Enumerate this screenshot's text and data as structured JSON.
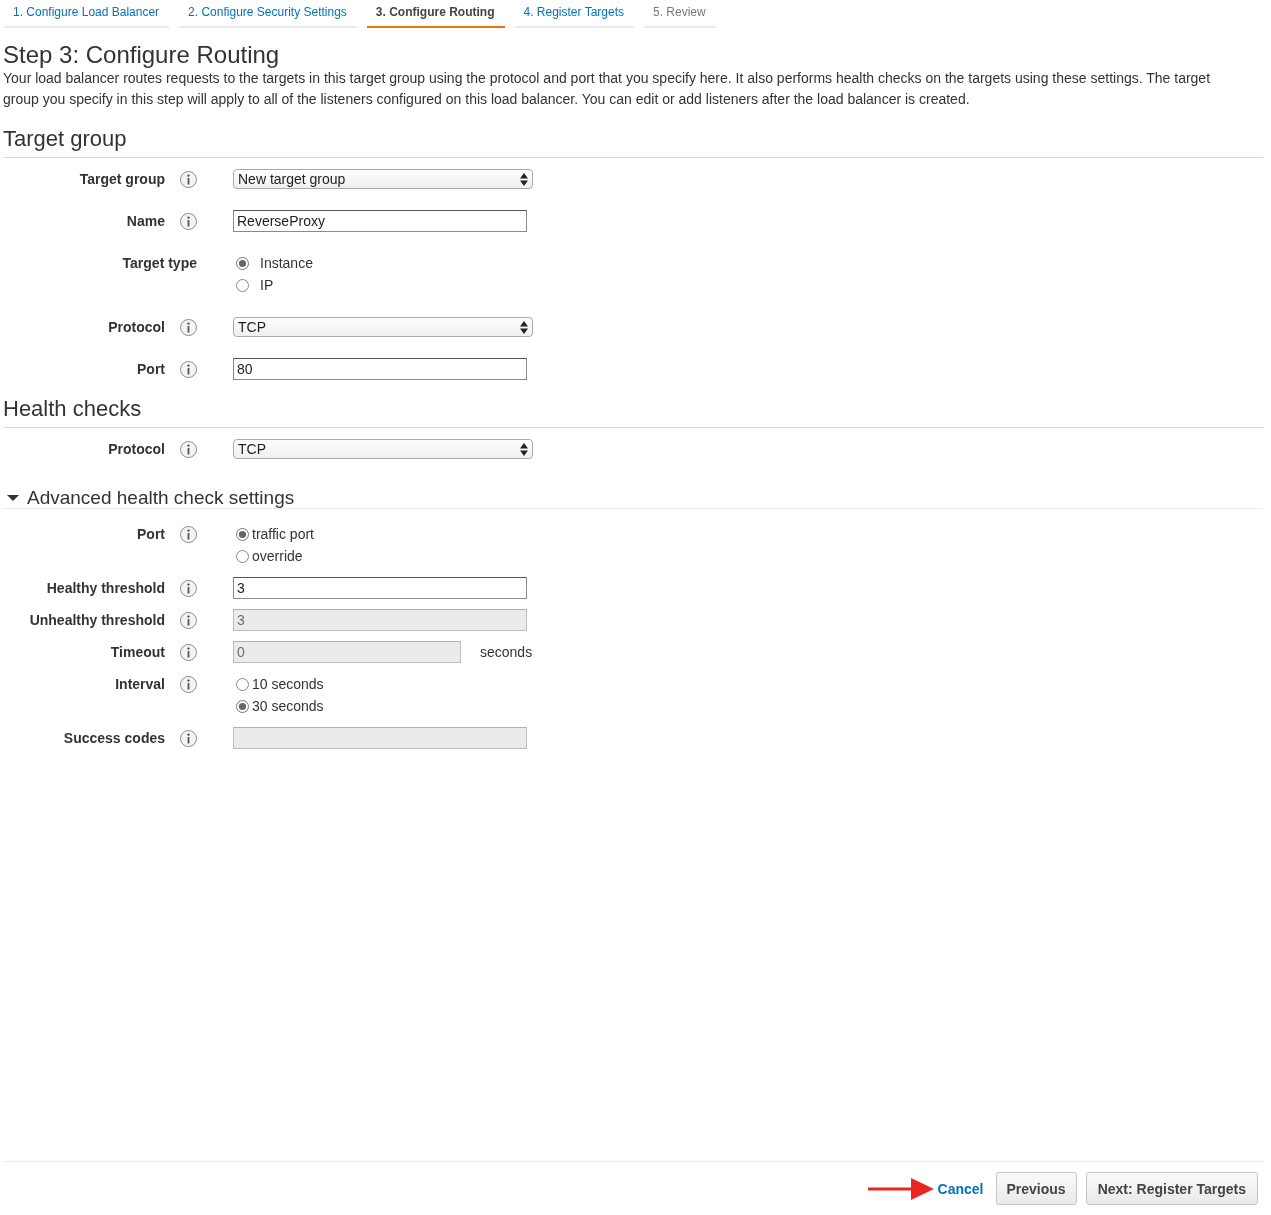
{
  "tabs": [
    {
      "label": "1. Configure Load Balancer",
      "selected": false,
      "disabled": false
    },
    {
      "label": "2. Configure Security Settings",
      "selected": false,
      "disabled": false
    },
    {
      "label": "3. Configure Routing",
      "selected": true,
      "disabled": false
    },
    {
      "label": "4. Register Targets",
      "selected": false,
      "disabled": false
    },
    {
      "label": "5. Review",
      "selected": false,
      "disabled": true
    }
  ],
  "page": {
    "title": "Step 3: Configure Routing",
    "description": "Your load balancer routes requests to the targets in this target group using the protocol and port that you specify here. It also performs health checks on the targets using these settings. The target group you specify in this step will apply to all of the listeners configured on this load balancer. You can edit or add listeners after the load balancer is created."
  },
  "sections": [
    {
      "title": "Target group",
      "kind": "plain",
      "fields": [
        {
          "label": "Target group",
          "info": true,
          "kind": "select",
          "value": "New target group"
        },
        {
          "label": "Name",
          "info": true,
          "kind": "input",
          "value": "ReverseProxy",
          "disabled": false
        },
        {
          "label": "Target type",
          "info": false,
          "kind": "radio",
          "options": [
            {
              "label": "Instance",
              "selected": true
            },
            {
              "label": "IP",
              "selected": false
            }
          ]
        },
        {
          "label": "Protocol",
          "info": true,
          "kind": "select",
          "value": "TCP"
        },
        {
          "label": "Port",
          "info": true,
          "kind": "input",
          "value": "80",
          "disabled": false
        }
      ]
    },
    {
      "title": "Health checks",
      "kind": "plain",
      "fields": [
        {
          "label": "Protocol",
          "info": true,
          "kind": "select",
          "value": "TCP"
        }
      ]
    },
    {
      "title": "Advanced health check settings",
      "kind": "collapsible",
      "expanded": true,
      "fields": [
        {
          "label": "Port",
          "info": true,
          "kind": "radio",
          "options": [
            {
              "label": "traffic port",
              "selected": true
            },
            {
              "label": "override",
              "selected": false
            }
          ]
        },
        {
          "label": "Healthy threshold",
          "info": true,
          "kind": "input",
          "value": "3",
          "disabled": false
        },
        {
          "label": "Unhealthy threshold",
          "info": true,
          "kind": "input",
          "value": "3",
          "disabled": true
        },
        {
          "label": "Timeout",
          "info": true,
          "kind": "input",
          "value": "0",
          "disabled": true,
          "suffix": "seconds"
        },
        {
          "label": "Interval",
          "info": true,
          "kind": "radio",
          "options": [
            {
              "label": "10 seconds",
              "selected": false
            },
            {
              "label": "30 seconds",
              "selected": true
            }
          ]
        },
        {
          "label": "Success codes",
          "info": true,
          "kind": "input",
          "disabled": true
        }
      ]
    }
  ],
  "footer": {
    "cancel": "Cancel",
    "previous": "Previous",
    "next": "Next: Register Targets"
  }
}
